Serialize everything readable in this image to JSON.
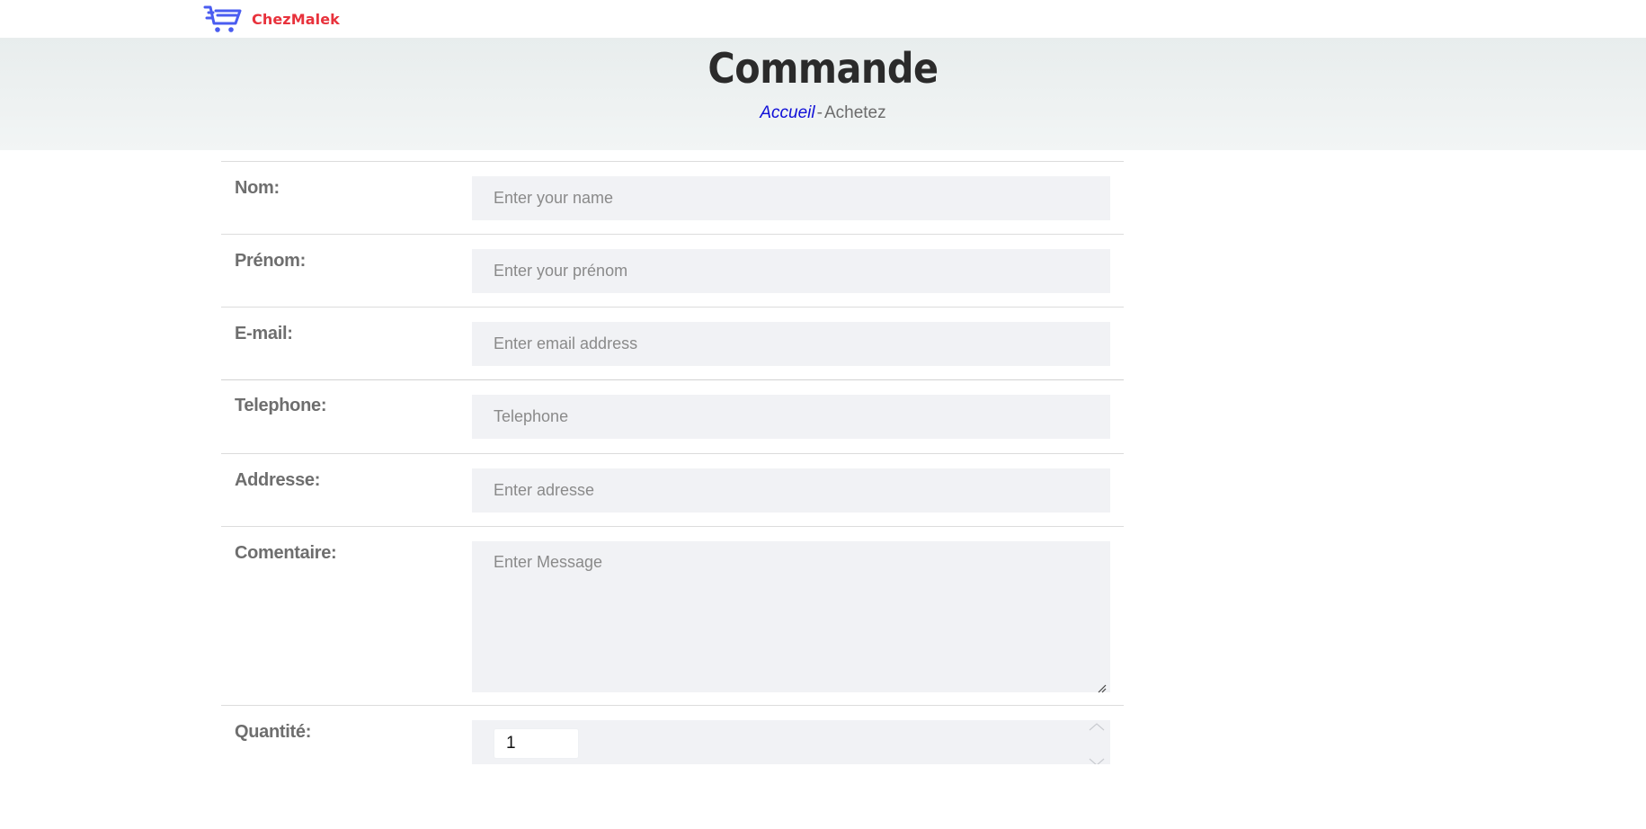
{
  "brand": {
    "name": "ChezMalek",
    "icon": "shopping-cart-icon",
    "icon_color": "#4a5cf0",
    "text_color": "#e8323c"
  },
  "hero": {
    "title": "Commande",
    "breadcrumb": {
      "home_label": "Accueil",
      "separator": "-",
      "current_label": "Achetez"
    }
  },
  "form": {
    "nom": {
      "label": "Nom:",
      "placeholder": "Enter your name",
      "value": ""
    },
    "prenom": {
      "label": "Prénom:",
      "placeholder": "Enter your prénom",
      "value": ""
    },
    "email": {
      "label": "E-mail:",
      "placeholder": "Enter email address",
      "value": ""
    },
    "telephone": {
      "label": "Telephone:",
      "placeholder": "Telephone",
      "value": ""
    },
    "adresse": {
      "label": "Addresse:",
      "placeholder": "Enter adresse",
      "value": ""
    },
    "commentaire": {
      "label": "Comentaire:",
      "placeholder": "Enter Message",
      "value": ""
    },
    "quantite": {
      "label": "Quantité:",
      "value": "1"
    }
  },
  "colors": {
    "hero_bg": "#eef2f2",
    "field_bg": "#f1f2f5",
    "link": "#1010d8",
    "label": "#6e6e6e"
  }
}
